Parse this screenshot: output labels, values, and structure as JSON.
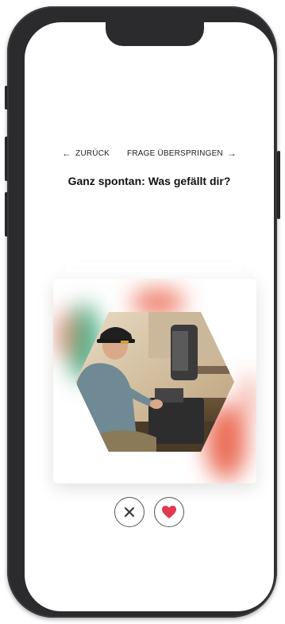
{
  "nav": {
    "back_label": "ZURÜCK",
    "skip_label": "FRAGE ÜBERSPRINGEN"
  },
  "question": "Ganz spontan: Was gefällt dir?",
  "card": {
    "image_subject": "photo-craftsman-at-workbench"
  },
  "actions": {
    "dislike_icon": "close-icon",
    "like_icon": "heart-icon"
  },
  "colors": {
    "heart": "#e0394f",
    "blob_green": "#2e9e6f",
    "blob_red": "#e8543a",
    "phone_frame": "#2b2b2e"
  }
}
